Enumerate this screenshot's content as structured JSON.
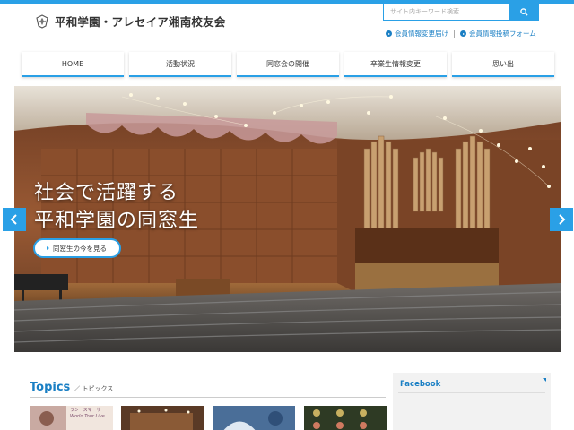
{
  "site": {
    "title": "平和学園・アレセイア湘南校友会"
  },
  "search": {
    "placeholder": "サイト内キーワード検索"
  },
  "util_links": [
    {
      "label": "会員情報変更届け"
    },
    {
      "label": "会員情報投稿フォーム"
    }
  ],
  "nav": [
    {
      "label": "HOME"
    },
    {
      "label": "活動状況"
    },
    {
      "label": "同窓会の開催"
    },
    {
      "label": "卒業生情報変更"
    },
    {
      "label": "思い出"
    }
  ],
  "hero": {
    "line1": "社会で活躍する",
    "line2": "平和学園の同窓生",
    "button_label": "同窓生の今を見る"
  },
  "topics": {
    "title_en": "Topics",
    "title_jp": "／ トピックス",
    "thumb_texts": [
      "ラシースマーサ",
      "World Tour Live"
    ]
  },
  "sidebar": {
    "facebook_title": "Facebook"
  },
  "colors": {
    "accent": "#2aa0e6",
    "link": "#1a7fc4"
  }
}
